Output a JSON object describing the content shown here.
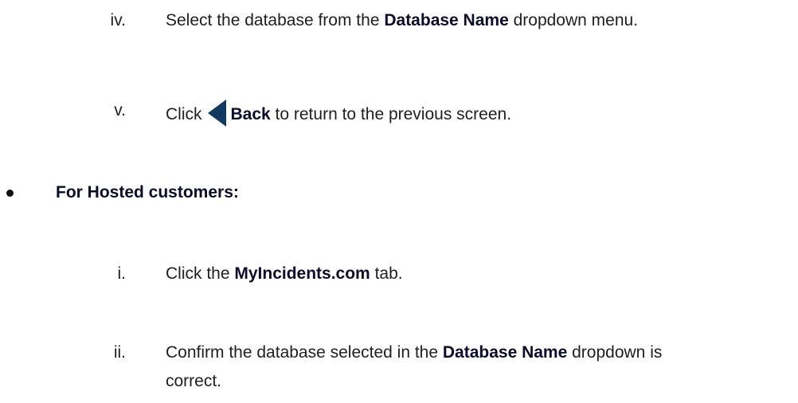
{
  "steps_direct": [
    {
      "numeral": "iv.",
      "prefix": "Select the database from the ",
      "bold": "Database Name",
      "suffix": " dropdown menu."
    },
    {
      "numeral": "v.",
      "prefix": "Click",
      "icon": "back-arrow-icon",
      "bold": "Back",
      "suffix": " to return to the previous screen."
    }
  ],
  "hosted_section": {
    "bullet_label": "For Hosted customers:",
    "steps": [
      {
        "numeral": "i.",
        "prefix": "Click the ",
        "bold": "MyIncidents.com",
        "suffix": " tab."
      },
      {
        "numeral": "ii.",
        "prefix": "Confirm the database selected in the ",
        "bold": "Database Name",
        "suffix": " dropdown is",
        "continuation": "correct."
      }
    ]
  },
  "colors": {
    "text": "#1f1f1f",
    "bold_text": "#0b0b2a",
    "icon": "#12395f"
  }
}
